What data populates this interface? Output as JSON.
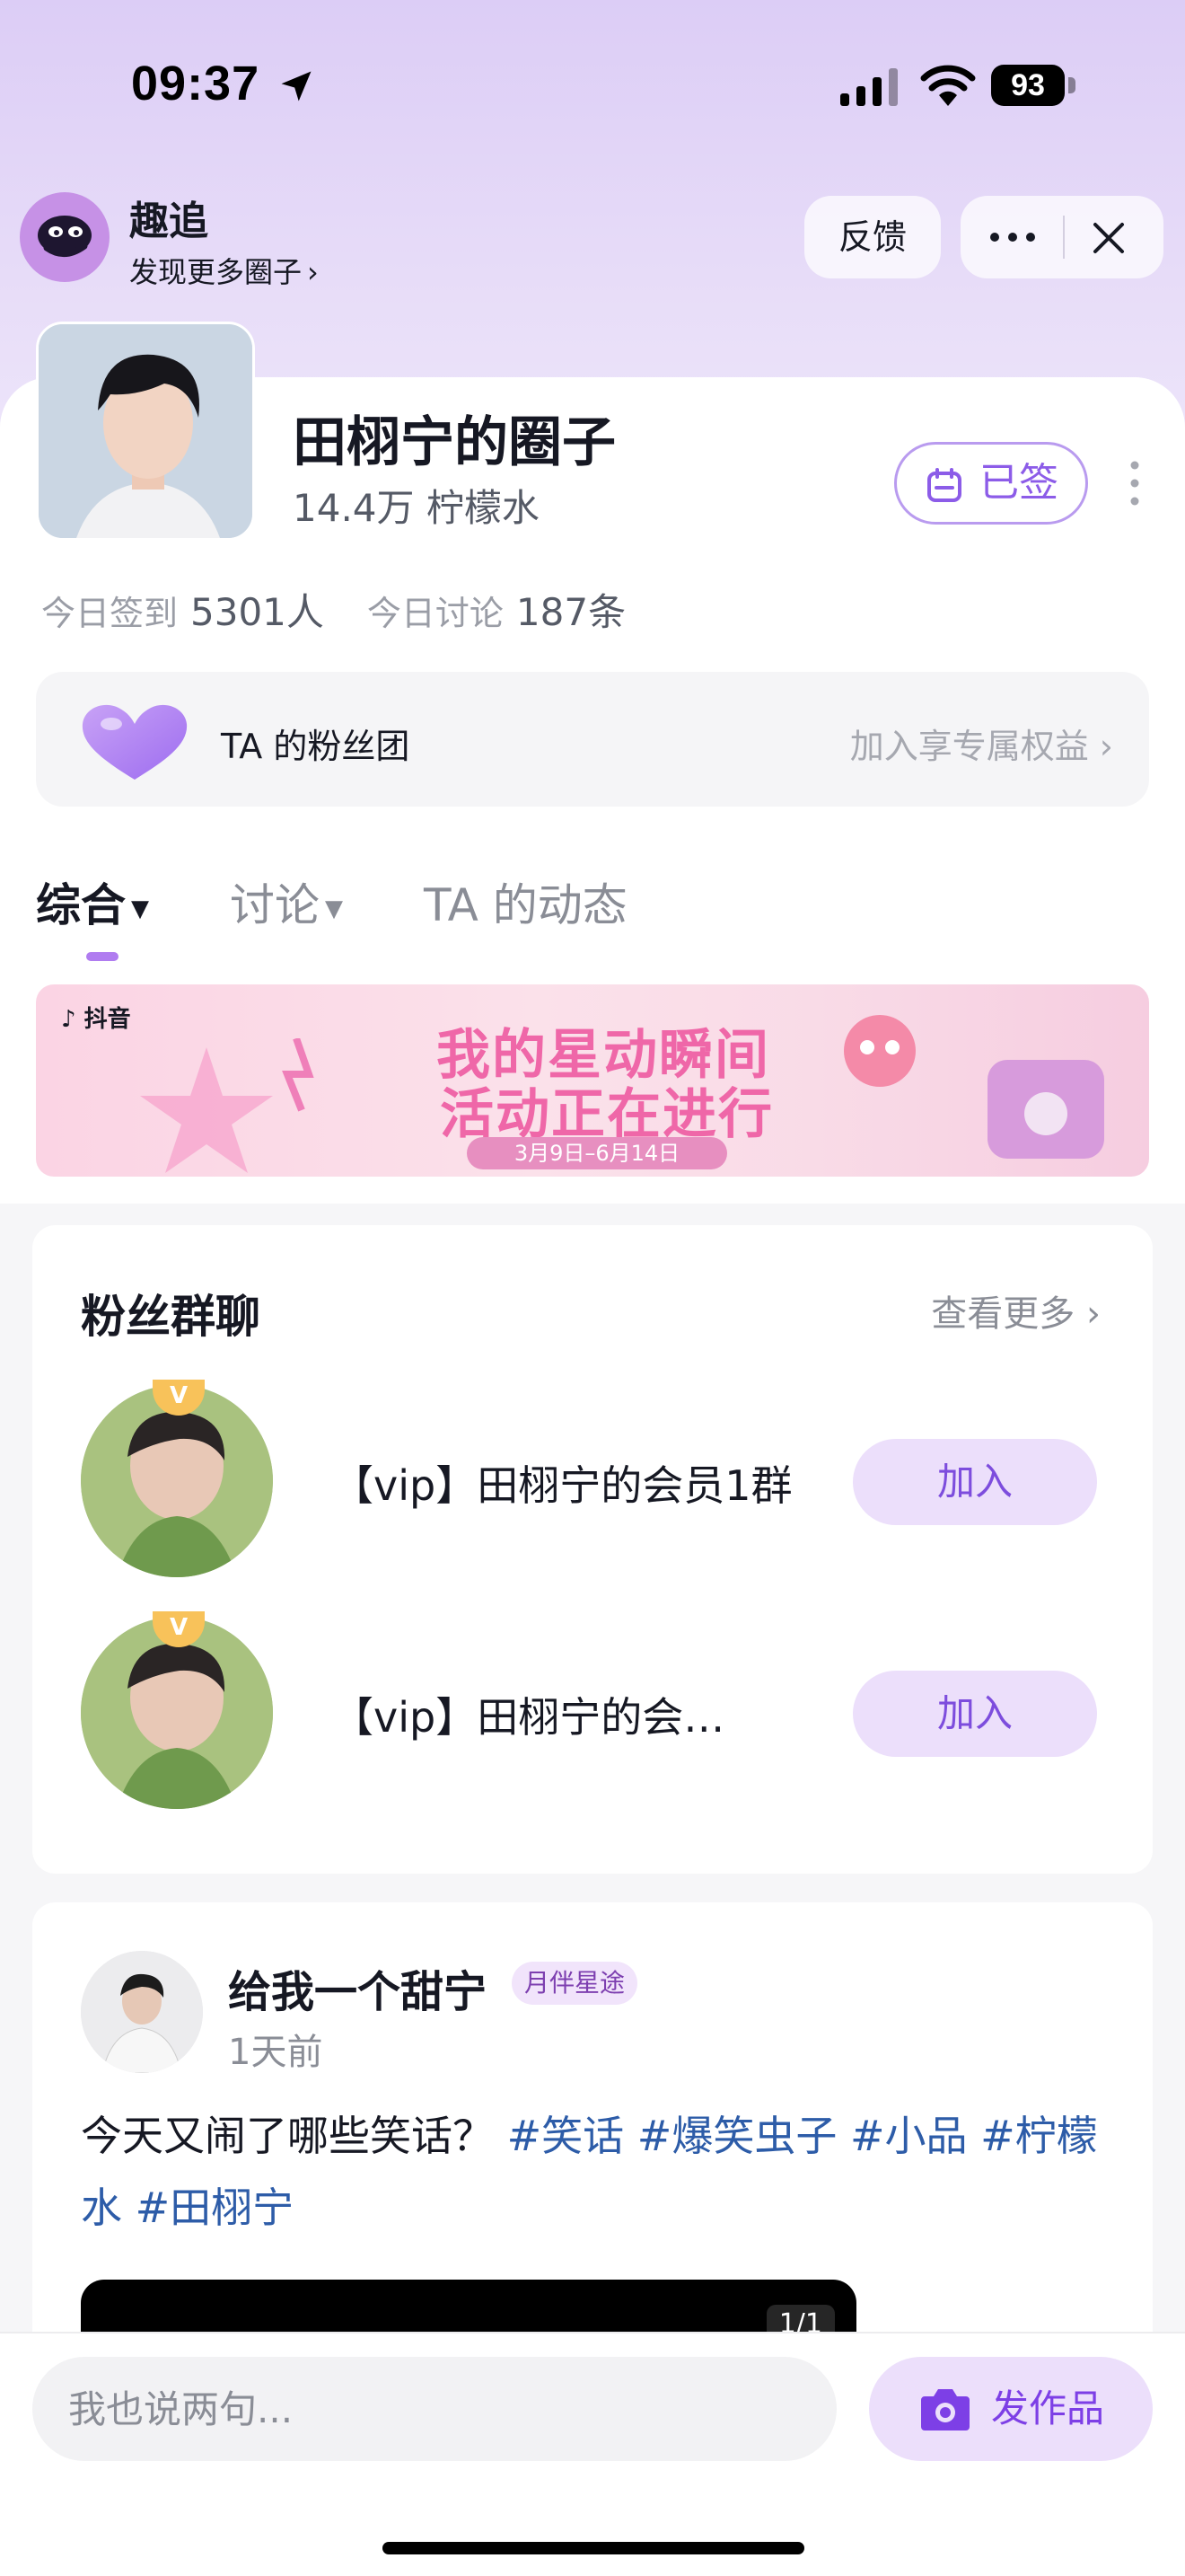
{
  "status_bar": {
    "time": "09:37",
    "battery": "93"
  },
  "mini_app": {
    "name": "趣追",
    "discover": "发现更多圈子",
    "feedback": "反馈"
  },
  "circle": {
    "title": "田栩宁的圈子",
    "members": "14.4万 柠檬水",
    "checked_in_label": "已签",
    "checkin_today_label": "今日签到",
    "checkin_today_value": "5301人",
    "discuss_today_label": "今日讨论",
    "discuss_today_value": "187条"
  },
  "fan_club": {
    "label": "TA 的粉丝团",
    "action": "加入享专属权益"
  },
  "tabs": [
    {
      "label": "综合",
      "active": true
    },
    {
      "label": "讨论",
      "active": false
    },
    {
      "label": "TA 的动态",
      "active": false
    }
  ],
  "banner": {
    "platform": "抖音",
    "line1": "我的星动瞬间",
    "line2": "活动正在进行",
    "dates": "3月9日–6月14日"
  },
  "fan_groups": {
    "title": "粉丝群聊",
    "more": "查看更多",
    "items": [
      {
        "badge": "V",
        "name": "【vip】田栩宁的会员1群",
        "join": "加入"
      },
      {
        "badge": "V",
        "name": "【vip】田栩宁的会…",
        "join": "加入"
      }
    ]
  },
  "post": {
    "author": "给我一个甜宁",
    "badge": "月伴星途",
    "time": "1天前",
    "text": "今天又闹了哪些笑话？",
    "tags": [
      "#笑话",
      "#爆笑虫子",
      "#小品",
      "#柠檬水",
      "#田栩宁"
    ],
    "media_count": "1/1"
  },
  "bottom": {
    "input_placeholder": "我也说两句...",
    "post_button": "发作品"
  },
  "colors": {
    "accent": "#8c5ce8",
    "tag": "#2d5ca8",
    "join_bg": "#ecdffb"
  }
}
